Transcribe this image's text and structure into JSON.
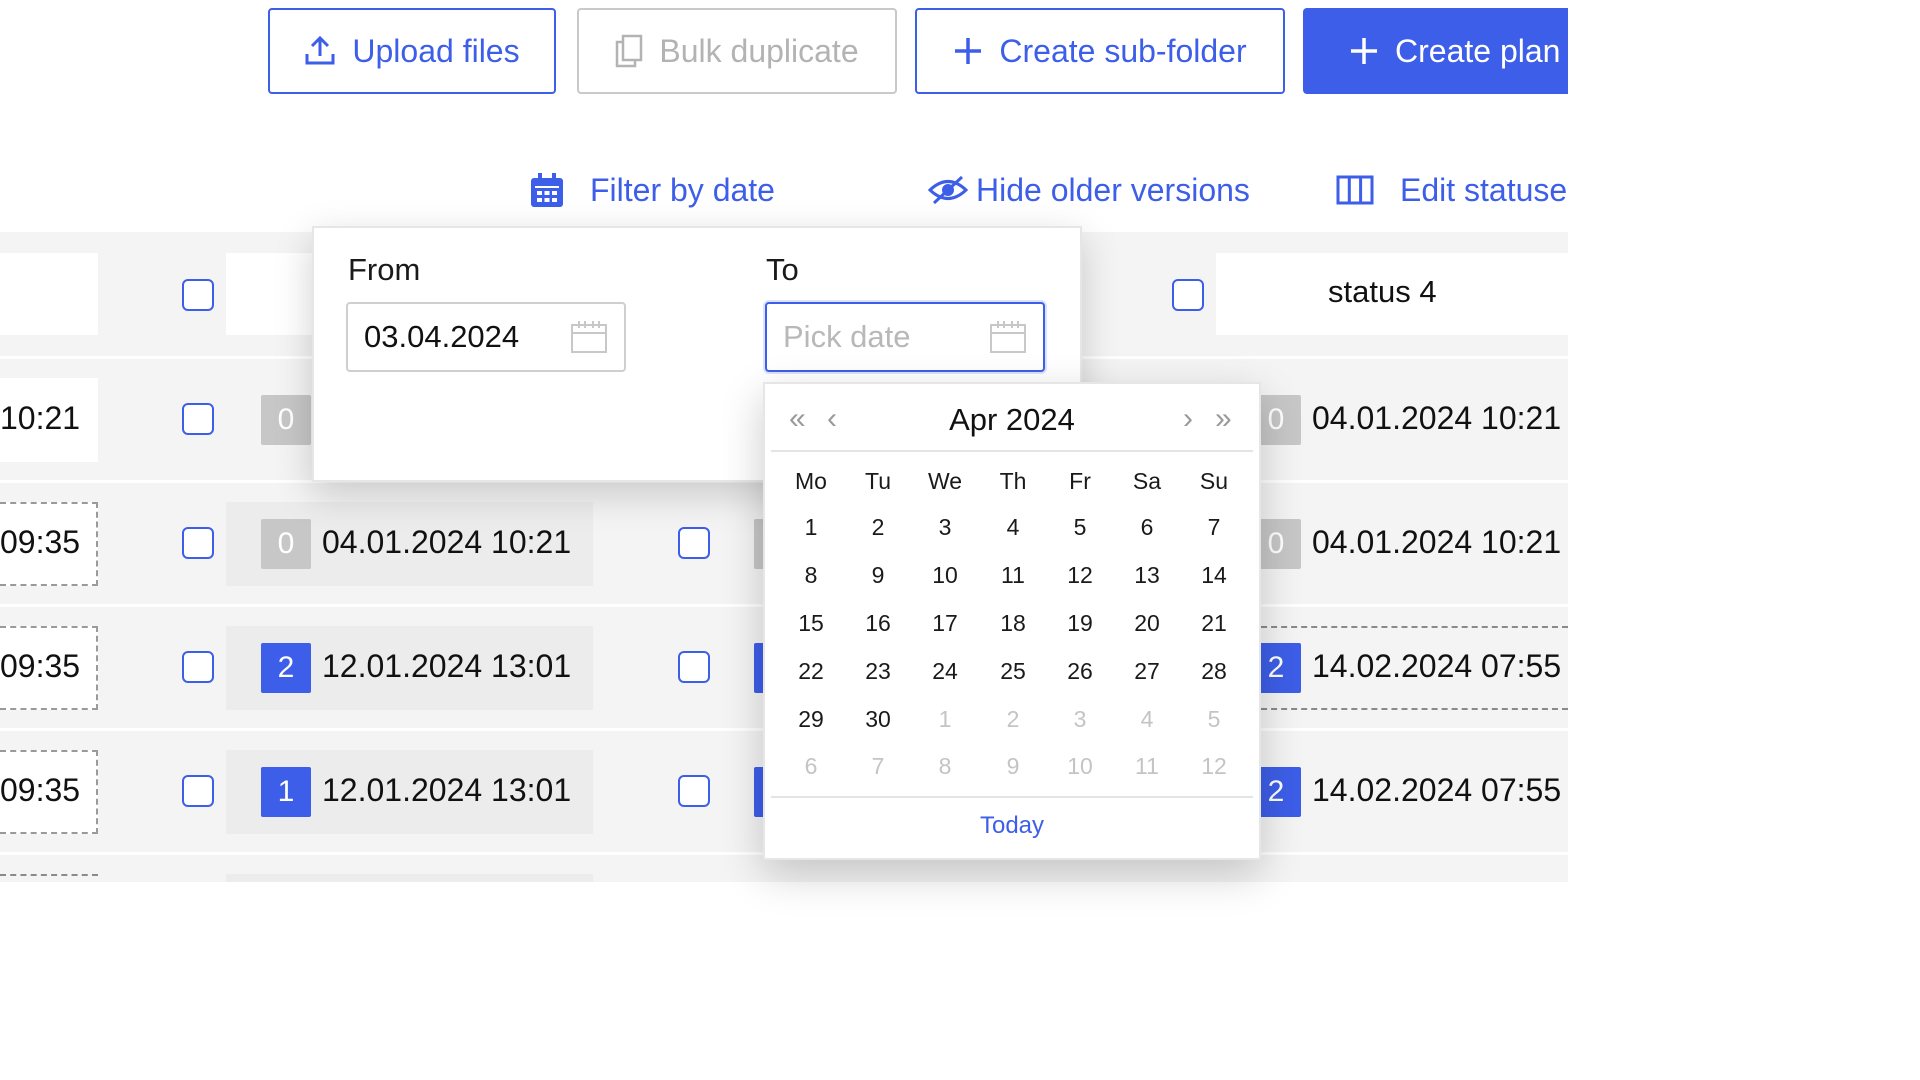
{
  "header": {
    "upload_label": "Upload files",
    "bulk_duplicate_label": "Bulk duplicate",
    "create_subfolder_label": "Create sub-folder",
    "create_plan_label": "Create plan"
  },
  "toolbar": {
    "filter_by_date": "Filter by date",
    "hide_older_versions": "Hide older versions",
    "edit_statuses": "Edit statuse"
  },
  "table": {
    "header_status": "status 4",
    "rows": [
      {
        "left_time": "10:21",
        "badge1": "0",
        "badge2": "0",
        "right_date": "04.01.2024 10:21"
      },
      {
        "left_time": "09:35",
        "badge1": "0",
        "date1": "04.01.2024 10:21",
        "badge2": "0",
        "right_date": "04.01.2024 10:21"
      },
      {
        "left_time": "09:35",
        "badge1": "2",
        "date1": "12.01.2024 13:01",
        "badge2": "2",
        "right_date": "14.02.2024 07:55"
      },
      {
        "left_time": "09:35",
        "badge1": "1",
        "date1": "12.01.2024 13:01",
        "badge2": "2",
        "right_date": "14.02.2024 07:55"
      }
    ]
  },
  "date_filter": {
    "from_label": "From",
    "from_value": "03.04.2024",
    "to_label": "To",
    "to_placeholder": "Pick date"
  },
  "calendar": {
    "title": "Apr 2024",
    "weekdays": [
      "Mo",
      "Tu",
      "We",
      "Th",
      "Fr",
      "Sa",
      "Su"
    ],
    "weeks": [
      [
        "1",
        "2",
        "3",
        "4",
        "5",
        "6",
        "7"
      ],
      [
        "8",
        "9",
        "10",
        "11",
        "12",
        "13",
        "14"
      ],
      [
        "15",
        "16",
        "17",
        "18",
        "19",
        "20",
        "21"
      ],
      [
        "22",
        "23",
        "24",
        "25",
        "26",
        "27",
        "28"
      ],
      [
        "29",
        "30",
        "1",
        "2",
        "3",
        "4",
        "5"
      ],
      [
        "6",
        "7",
        "8",
        "9",
        "10",
        "11",
        "12"
      ]
    ],
    "out_of_month_from_index": 30,
    "today_label": "Today"
  },
  "colors": {
    "accent": "#3d5ee8",
    "badge_grey": "#c7c7c7"
  }
}
